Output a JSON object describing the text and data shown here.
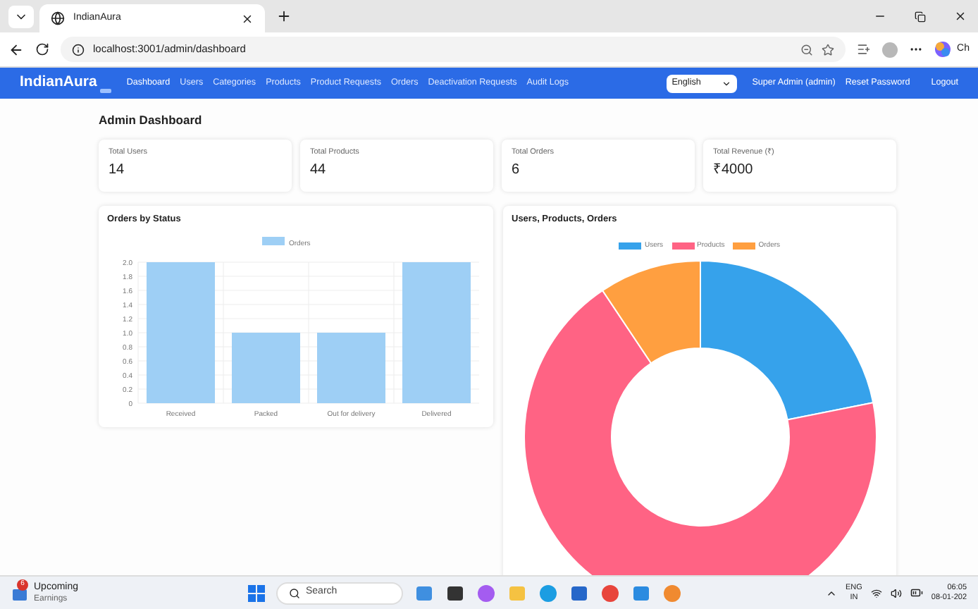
{
  "browser": {
    "tab_title": "IndianAura",
    "url": "localhost:3001/admin/dashboard",
    "profile_label": "Ch"
  },
  "navbar": {
    "brand": "IndianAura",
    "links": [
      {
        "label": "Dashboard",
        "selected": true
      },
      {
        "label": "Users",
        "selected": false
      },
      {
        "label": "Categories",
        "selected": false
      },
      {
        "label": "Products",
        "selected": false
      },
      {
        "label": "Product Requests",
        "selected": false
      },
      {
        "label": "Orders",
        "selected": false
      },
      {
        "label": "Deactivation Requests",
        "selected": false
      },
      {
        "label": "Audit Logs",
        "selected": false
      }
    ],
    "language": "English",
    "user": "Super Admin (admin)",
    "reset": "Reset Password",
    "logout": "Logout"
  },
  "page": {
    "title": "Admin Dashboard",
    "stats": [
      {
        "label": "Total Users",
        "value": "14"
      },
      {
        "label": "Total Products",
        "value": "44"
      },
      {
        "label": "Total Orders",
        "value": "6"
      },
      {
        "label": "Total Revenue (₹)",
        "value": "₹4000"
      }
    ],
    "bar_card": {
      "title": "Orders by Status",
      "chart_data": {
        "type": "bar",
        "categories": [
          "Received",
          "Packed",
          "Out for delivery",
          "Delivered"
        ],
        "series": [
          {
            "name": "Orders",
            "color": "#9ecff5",
            "values": [
              2,
              1,
              1,
              2
            ]
          }
        ],
        "ylim": [
          0,
          2
        ],
        "grid": true,
        "yticks": [
          {
            "value": 0,
            "label": "0"
          },
          {
            "value": 0.2,
            "label": "0.2"
          },
          {
            "value": 0.4,
            "label": "0.4"
          },
          {
            "value": 0.6,
            "label": "0.6"
          },
          {
            "value": 0.8,
            "label": "0.8"
          },
          {
            "value": 1,
            "label": "1.0"
          },
          {
            "value": 1.2,
            "label": "1.2"
          },
          {
            "value": 1.4,
            "label": "1.4"
          },
          {
            "value": 1.6,
            "label": "1.6"
          },
          {
            "value": 1.8,
            "label": "1.8"
          },
          {
            "value": 2,
            "label": "2.0"
          }
        ]
      }
    },
    "donut_card": {
      "title": "Users, Products, Orders",
      "legend": [
        {
          "label": "Users",
          "color": "#36a2eb"
        },
        {
          "label": "Products",
          "color": "#ff6384"
        },
        {
          "label": "Orders",
          "color": "#ff9f40"
        }
      ]
    }
  },
  "taskbar": {
    "widget_title": "Upcoming",
    "widget_subtitle": "Earnings",
    "widget_badge": "6",
    "search_placeholder": "Search",
    "lang_top": "ENG",
    "lang_bottom": "IN",
    "time": "06:05",
    "date": "08-01-202"
  }
}
